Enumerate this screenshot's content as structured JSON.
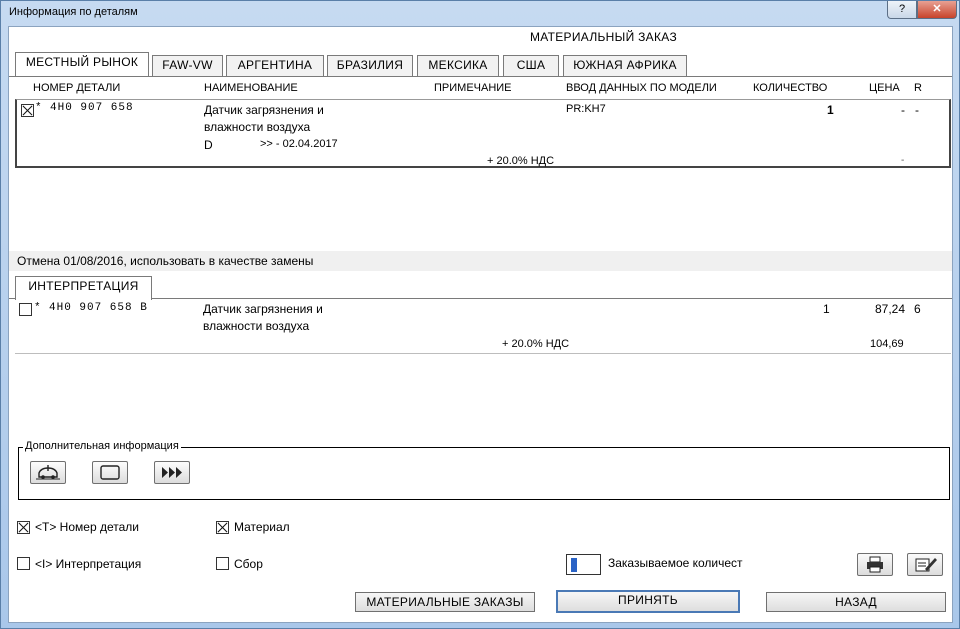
{
  "window": {
    "title": "Информация по деталям",
    "help_label": "?",
    "close_label": "✕"
  },
  "header": {
    "title": "МАТЕРИАЛЬНЫЙ ЗАКАЗ"
  },
  "market_tabs": [
    "МЕСТНЫЙ РЫНОК",
    "FAW-VW",
    "АРГЕНТИНА",
    "БРАЗИЛИЯ",
    "МЕКСИКА",
    "США",
    "ЮЖНАЯ АФРИКА"
  ],
  "columns": {
    "part_no": "НОМЕР ДЕТАЛИ",
    "name": "НАИМЕНОВАНИЕ",
    "note": "ПРИМЕЧАНИЕ",
    "model_input": "ВВОД ДАННЫХ ПО МОДЕЛИ",
    "qty": "КОЛИЧЕСТВО",
    "price": "ЦЕНА",
    "r": "R"
  },
  "main_row": {
    "checked": true,
    "star": "*",
    "part_no": "4H0 907 658",
    "name_line1": "Датчик загрязнения и",
    "name_line2": "влажности воздуха",
    "code": "D",
    "validity": ">> - 02.04.2017",
    "model": "PR:KH7",
    "qty": "1",
    "price": "-",
    "r": "-",
    "vat": "+ 20.0% НДС",
    "vat_price": "-"
  },
  "replacement_note": "Отмена 01/08/2016, использовать в качестве замены",
  "interp_tab": "ИНТЕРПРЕТАЦИЯ",
  "replacement_row": {
    "checked": false,
    "star": "*",
    "part_no": "4H0 907 658 B",
    "name_line1": "Датчик загрязнения и",
    "name_line2": "влажности воздуха",
    "qty": "1",
    "price": "87,24",
    "r": "6",
    "vat": "+ 20.0% НДС",
    "vat_price": "104,69"
  },
  "additional_info": {
    "legend": "Дополнительная информация",
    "icons": [
      "car-info-icon",
      "frame-icon",
      "forward-arrows-icon"
    ]
  },
  "options": {
    "part_number": {
      "label": "<T> Номер детали",
      "checked": true
    },
    "material": {
      "label": "Материал",
      "checked": true
    },
    "interpretation": {
      "label": "<I> Интерпретация",
      "checked": false
    },
    "assembly": {
      "label": "Сбор",
      "checked": false
    }
  },
  "order_qty": {
    "label": "Заказываемое количест",
    "value": ""
  },
  "buttons": {
    "material_orders": "МАТЕРИАЛЬНЫЕ ЗАКАЗЫ",
    "accept": "ПРИНЯТЬ",
    "back": "НАЗАД"
  },
  "toolbar_icons": [
    "print-icon",
    "edit-icon"
  ]
}
